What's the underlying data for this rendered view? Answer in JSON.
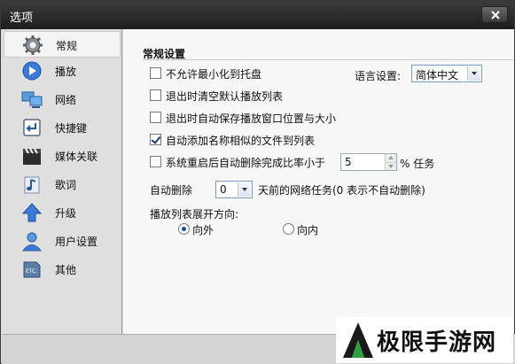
{
  "window": {
    "title": "选项"
  },
  "sidebar": {
    "items": [
      {
        "label": "常规",
        "icon": "gear-icon",
        "active": true
      },
      {
        "label": "播放",
        "icon": "play-icon"
      },
      {
        "label": "网络",
        "icon": "network-icon"
      },
      {
        "label": "快捷键",
        "icon": "enter-key-icon"
      },
      {
        "label": "媒体关联",
        "icon": "clapperboard-icon"
      },
      {
        "label": "歌词",
        "icon": "music-note-icon"
      },
      {
        "label": "升级",
        "icon": "up-arrow-icon"
      },
      {
        "label": "用户设置",
        "icon": "user-icon"
      },
      {
        "label": "其他",
        "icon": "etc-icon"
      }
    ]
  },
  "general": {
    "section_title": "常规设置",
    "opt_no_minimize_tray": "不允许最小化到托盘",
    "language_label": "语言设置:",
    "language_value": "简体中文",
    "opt_clear_playlist": "退出时清空默认播放列表",
    "opt_save_window": "退出时自动保存播放窗口位置与大小",
    "opt_add_similar": "自动添加名称相似的文件到列表",
    "opt_delete_on_restart": "系统重启后自动删除完成比率小于",
    "delete_ratio_value": "5",
    "delete_ratio_suffix": "% 任务",
    "auto_delete_label": "自动删除",
    "auto_delete_days": "0",
    "auto_delete_suffix": "天前的网络任务(0 表示不自动删除)",
    "playlist_direction_label": "播放列表展开方向:",
    "direction_outward": "向外",
    "direction_inward": "向内"
  },
  "checkbox_states": {
    "no_minimize_tray": false,
    "clear_playlist": false,
    "save_window": false,
    "add_similar": true,
    "delete_on_restart": false
  },
  "watermark": {
    "text": "极限手游网"
  }
}
